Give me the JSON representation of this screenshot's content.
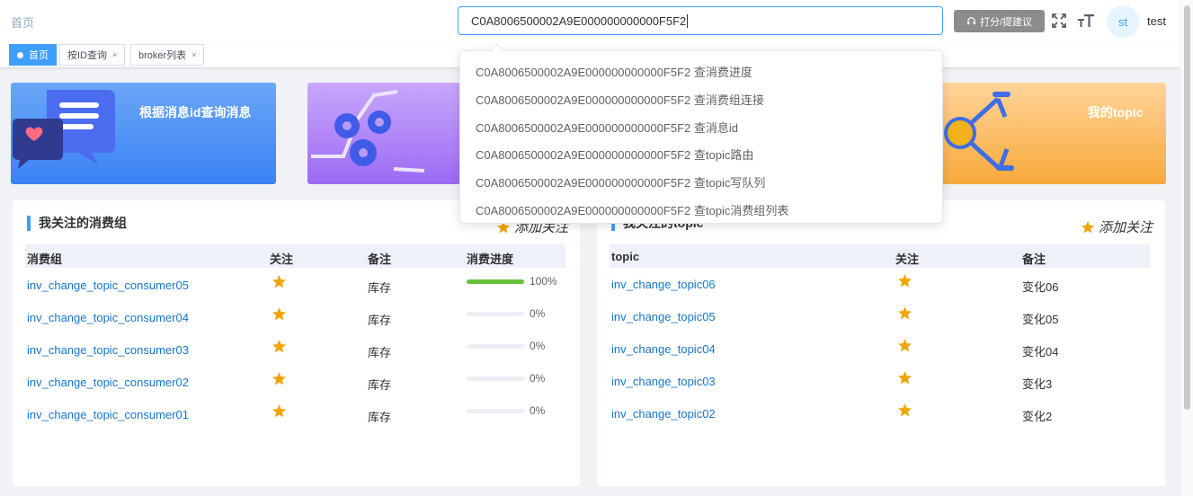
{
  "header": {
    "breadcrumb": "首页",
    "search_value": "C0A8006500002A9E000000000000F5F2",
    "rate_button": "打分/提建议",
    "avatar_text": "st",
    "username": "test"
  },
  "tags": [
    {
      "label": "首页",
      "active": true
    },
    {
      "label": "按ID查询",
      "close": "×"
    },
    {
      "label": "broker列表",
      "close": "×"
    }
  ],
  "banners": {
    "message": {
      "title": "根据消息id查询消息"
    },
    "topic": {
      "title": "我的topic"
    }
  },
  "dropdown": {
    "items": [
      "C0A8006500002A9E000000000000F5F2 查消费进度",
      "C0A8006500002A9E000000000000F5F2 查消费组连接",
      "C0A8006500002A9E000000000000F5F2 查消息id",
      "C0A8006500002A9E000000000000F5F2 查topic路由",
      "C0A8006500002A9E000000000000F5F2 查topic写队列",
      "C0A8006500002A9E000000000000F5F2 查topic消费组列表"
    ]
  },
  "consumer_card": {
    "title": "我关注的消费组",
    "add_follow": "添加关注",
    "columns": [
      "消费组",
      "关注",
      "备注",
      "消费进度"
    ],
    "rows": [
      {
        "name": "inv_change_topic_consumer05",
        "remark": "库存",
        "progress": 100,
        "progress_label": "100%"
      },
      {
        "name": "inv_change_topic_consumer04",
        "remark": "库存",
        "progress": 0,
        "progress_label": "0%"
      },
      {
        "name": "inv_change_topic_consumer03",
        "remark": "库存",
        "progress": 0,
        "progress_label": "0%"
      },
      {
        "name": "inv_change_topic_consumer02",
        "remark": "库存",
        "progress": 0,
        "progress_label": "0%"
      },
      {
        "name": "inv_change_topic_consumer01",
        "remark": "库存",
        "progress": 0,
        "progress_label": "0%"
      }
    ]
  },
  "topic_card": {
    "title": "我关注的topic",
    "add_follow": "添加关注",
    "columns": [
      "topic",
      "关注",
      "备注"
    ],
    "rows": [
      {
        "name": "inv_change_topic06",
        "remark": "变化06"
      },
      {
        "name": "inv_change_topic05",
        "remark": "变化05"
      },
      {
        "name": "inv_change_topic04",
        "remark": "变化04"
      },
      {
        "name": "inv_change_topic03",
        "remark": "变化3"
      },
      {
        "name": "inv_change_topic02",
        "remark": "变化2"
      }
    ]
  },
  "colors": {
    "primary": "#409eff",
    "link": "#1677cc",
    "star": "#f0a500",
    "progress": "#67c23a"
  }
}
